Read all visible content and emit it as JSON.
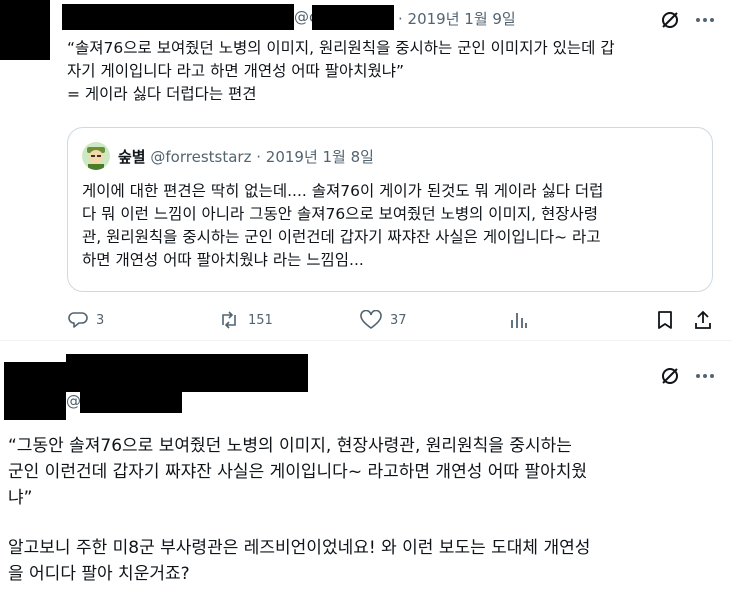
{
  "tweet1": {
    "handle_prefix": "@c",
    "date": "· 2019년 1월 9일",
    "lines": [
      "“솔져76으로 보여줬던 노병의 이미지, 원리원칙을 중시하는 군인 이미지가 있는데 갑",
      "자기 게이입니다 라고 하면 개연성 어따 팔아치웠냐”",
      "= 게이라 싫다 더럽다는 편견"
    ],
    "quote": {
      "name": "숲별",
      "handle": "@forreststarz",
      "date": "· 2019년 1월 8일",
      "lines": [
        "게이에 대한 편견은 딱히 없는데.... 솔져76이 게이가 된것도 뭐 게이라 싫다 더럽",
        "다 뭐 이런 느낌이 아니라 그동안 솔져76으로 보여줬던 노병의 이미지, 현장사령",
        "관, 원리원칙을 중시하는 군인 이런건데 갑자기 짜쟈잔 사실은 게이입니다~ 라고",
        "하면 개연성 어따 팔아치웠냐 라는 느낌임..."
      ]
    },
    "actions": {
      "replies": "3",
      "retweets": "151",
      "likes": "37"
    }
  },
  "tweet2": {
    "handle_prefix": "@",
    "lines": [
      "“그동안 솔져76으로 보여줬던 노병의 이미지, 현장사령관, 원리원칙을 중시하는",
      "군인 이런건데 갑자기 짜쟈잔 사실은 게이입니다~ 라고하면 개연성 어따 팔아치웠",
      "냐”",
      "",
      "알고보니 주한 미8군 부사령관은 레즈비언이었네요! 와 이런 보도는 도대체 개연성",
      "을 어디다 팔아 치운거죠?"
    ]
  },
  "icons": {
    "grok": "grok-icon",
    "more": "more-icon",
    "reply": "reply-icon",
    "retweet": "retweet-icon",
    "like": "like-icon",
    "views": "views-icon",
    "bookmark": "bookmark-icon",
    "share": "share-icon"
  },
  "colors": {
    "text": "#0f1419",
    "muted": "#536471",
    "border": "#cfd9de"
  }
}
